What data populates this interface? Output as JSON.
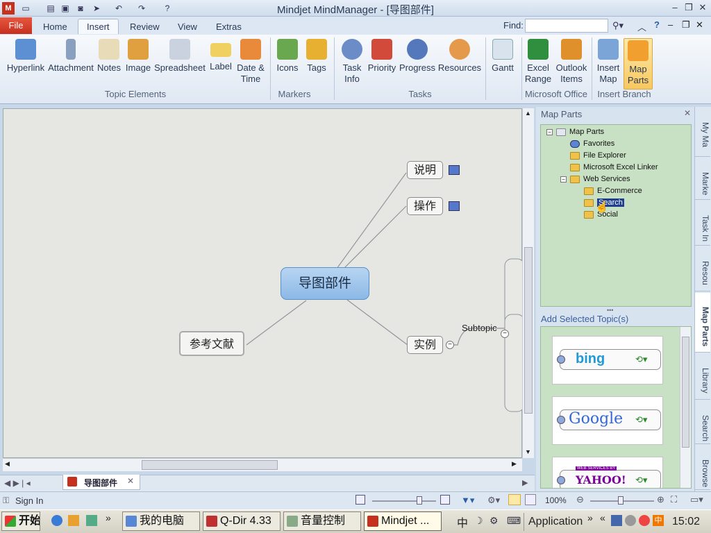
{
  "window": {
    "title": "Mindjet MindManager - [导图部件]"
  },
  "tabs": [
    {
      "label": "File"
    },
    {
      "label": "Home"
    },
    {
      "label": "Insert"
    },
    {
      "label": "Review"
    },
    {
      "label": "View"
    },
    {
      "label": "Extras"
    }
  ],
  "find": {
    "label": "Find:",
    "value": ""
  },
  "ribbon": {
    "groups": [
      {
        "label": "Topic Elements",
        "buttons": [
          "Hyperlink",
          "Attachment",
          "Notes",
          "Image",
          "Spreadsheet",
          "Label",
          "Date &",
          "Time"
        ]
      },
      {
        "label": "Markers",
        "buttons": [
          "Icons",
          "Tags"
        ]
      },
      {
        "label": "Tasks",
        "buttons": [
          "Task",
          "Info",
          "Priority",
          "Progress",
          "Resources"
        ]
      },
      {
        "label": "",
        "buttons": [
          "Gantt"
        ]
      },
      {
        "label": "Microsoft Office",
        "buttons": [
          "Excel",
          "Range",
          "Outlook",
          "Items"
        ]
      },
      {
        "label": "Insert Branch",
        "buttons": [
          "Insert",
          "Map",
          "Map",
          "Parts"
        ]
      }
    ]
  },
  "map": {
    "central": "导图部件",
    "topics": [
      "说明",
      "操作",
      "实例",
      "参考文献"
    ],
    "subtopic_label": "Subtopic"
  },
  "sheet": {
    "tab_label": "导图部件"
  },
  "panel": {
    "title": "Map Parts",
    "tree": [
      "Map Parts",
      "Favorites",
      "File Explorer",
      "Microsoft Excel Linker",
      "Web Services",
      "E-Commerce",
      "Search",
      "Social"
    ],
    "add_label": "Add Selected Topic(s)",
    "parts": [
      "bing",
      "Google",
      "WEB SERVICES BY",
      "YAHOO!"
    ]
  },
  "dock": [
    "My Ma",
    "Marke",
    "Task In",
    "Resou",
    "Map Parts",
    "Library",
    "Search",
    "Browse"
  ],
  "status": {
    "signin": "Sign In",
    "zoom": "100%"
  },
  "taskbar": {
    "start": "开始",
    "items": [
      "我的电脑",
      "Q-Dir 4.33",
      "音量控制",
      "Mindjet ..."
    ],
    "lang": "中",
    "application": "Application",
    "clock": "15:02"
  },
  "colors": {
    "file_tab": "#c5301f",
    "central_fill": "#9cc2ea",
    "panel_green": "#c8e0c4",
    "accent": "#3a5f9e"
  }
}
